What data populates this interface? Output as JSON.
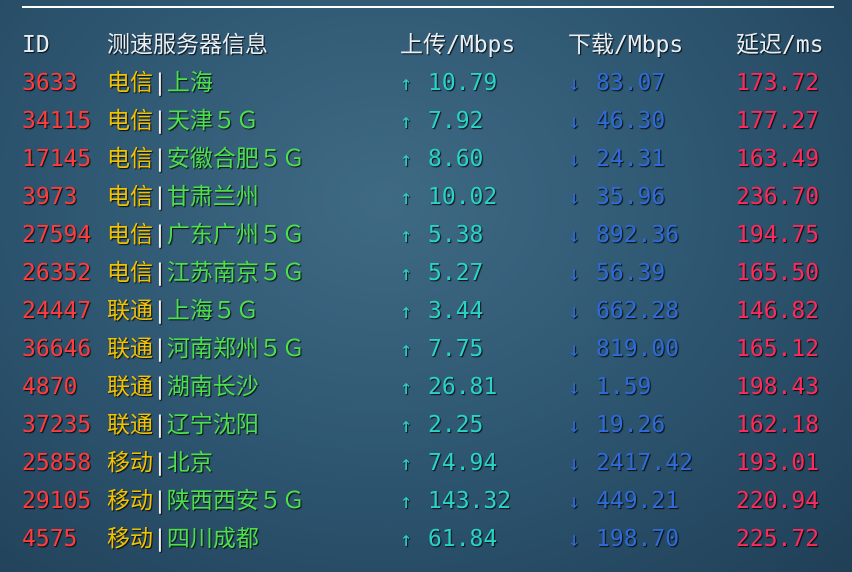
{
  "header": {
    "id": "ID",
    "node": "测速服务器信息",
    "upload": "上传/Mbps",
    "download": "下载/Mbps",
    "latency": "延迟/ms"
  },
  "arrows": {
    "up": "↑",
    "down": "↓",
    "separator": "|"
  },
  "colors": {
    "id": "#ff3b3b",
    "isp": "#f2c200",
    "location": "#4ce04c",
    "upload": "#29d4c6",
    "download": "#2f6bd6",
    "latency": "#ff2a5a"
  },
  "rows": [
    {
      "id": "3633",
      "isp": "电信",
      "location": "上海",
      "upload": "10.79",
      "download": "83.07",
      "latency": "173.72"
    },
    {
      "id": "34115",
      "isp": "电信",
      "location": "天津５Ｇ",
      "upload": "7.92",
      "download": "46.30",
      "latency": "177.27"
    },
    {
      "id": "17145",
      "isp": "电信",
      "location": "安徽合肥５Ｇ",
      "upload": "8.60",
      "download": "24.31",
      "latency": "163.49"
    },
    {
      "id": "3973",
      "isp": "电信",
      "location": "甘肃兰州",
      "upload": "10.02",
      "download": "35.96",
      "latency": "236.70"
    },
    {
      "id": "27594",
      "isp": "电信",
      "location": "广东广州５Ｇ",
      "upload": "5.38",
      "download": "892.36",
      "latency": "194.75"
    },
    {
      "id": "26352",
      "isp": "电信",
      "location": "江苏南京５Ｇ",
      "upload": "5.27",
      "download": "56.39",
      "latency": "165.50"
    },
    {
      "id": "24447",
      "isp": "联通",
      "location": "上海５Ｇ",
      "upload": "3.44",
      "download": "662.28",
      "latency": "146.82"
    },
    {
      "id": "36646",
      "isp": "联通",
      "location": "河南郑州５Ｇ",
      "upload": "7.75",
      "download": "819.00",
      "latency": "165.12"
    },
    {
      "id": "4870",
      "isp": "联通",
      "location": "湖南长沙",
      "upload": "26.81",
      "download": "1.59",
      "latency": "198.43"
    },
    {
      "id": "37235",
      "isp": "联通",
      "location": "辽宁沈阳",
      "upload": "2.25",
      "download": "19.26",
      "latency": "162.18"
    },
    {
      "id": "25858",
      "isp": "移动",
      "location": "北京",
      "upload": "74.94",
      "download": "2417.42",
      "latency": "193.01"
    },
    {
      "id": "29105",
      "isp": "移动",
      "location": "陕西西安５Ｇ",
      "upload": "143.32",
      "download": "449.21",
      "latency": "220.94"
    },
    {
      "id": "4575",
      "isp": "移动",
      "location": "四川成都",
      "upload": "61.84",
      "download": "198.70",
      "latency": "225.72"
    }
  ]
}
